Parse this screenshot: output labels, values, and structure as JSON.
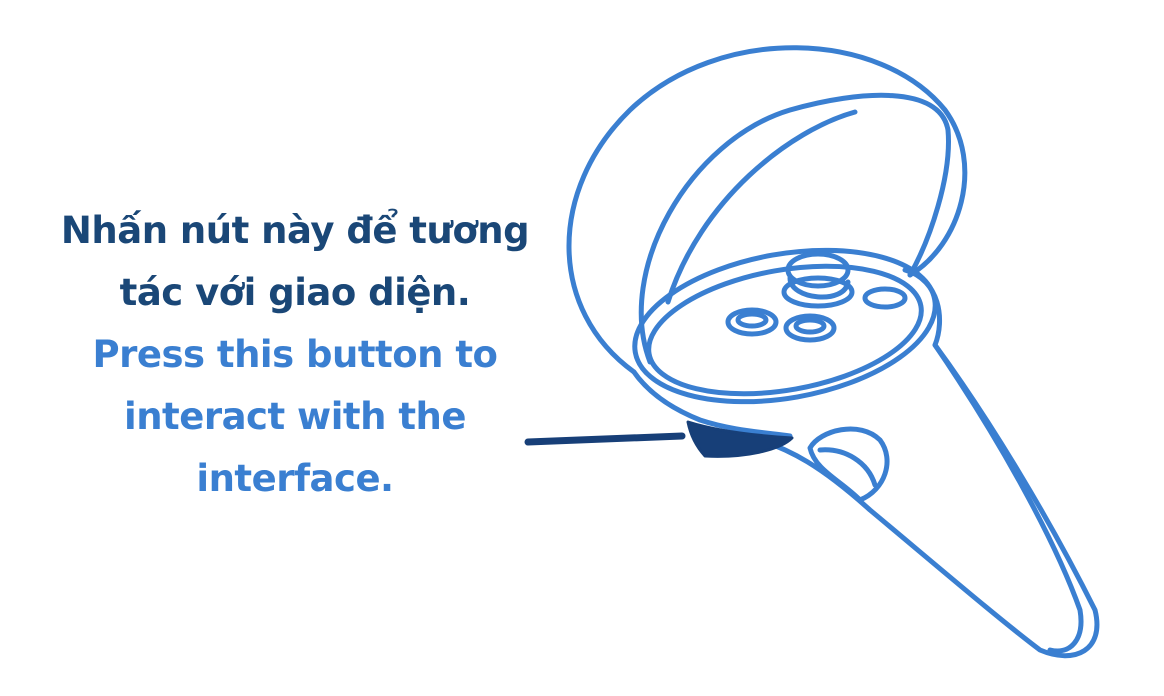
{
  "caption": {
    "vietnamese": "Nhấn nút này để tương tác với giao diện.",
    "english": "Press this button to interact with the interface."
  },
  "colors": {
    "outline": "#3a7fd1",
    "vietnamese_text": "#1a4777",
    "english_text": "#3a7fd1",
    "highlighted_button": "#173f78"
  },
  "icons": {
    "illustration": "vr-controller-icon",
    "pointer": "callout-line"
  }
}
